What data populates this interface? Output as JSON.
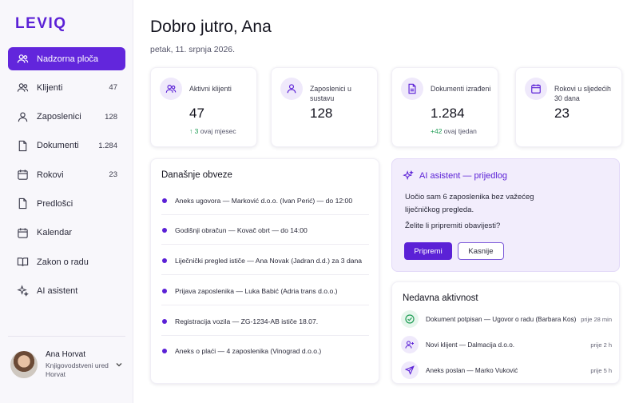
{
  "app": {
    "logo": "LEVIQ"
  },
  "sidebar": {
    "items": [
      {
        "label": "Nadzorna ploča",
        "count": "",
        "icon": "users-icon"
      },
      {
        "label": "Klijenti",
        "count": "47",
        "icon": "users-icon"
      },
      {
        "label": "Zaposlenici",
        "count": "128",
        "icon": "person-icon"
      },
      {
        "label": "Dokumenti",
        "count": "1.284",
        "icon": "document-icon"
      },
      {
        "label": "Rokovi",
        "count": "23",
        "icon": "calendar-icon"
      },
      {
        "label": "Predlošci",
        "count": "",
        "icon": "document-icon"
      },
      {
        "label": "Kalendar",
        "count": "",
        "icon": "calendar-icon"
      },
      {
        "label": "Zakon o radu",
        "count": "",
        "icon": "book-icon"
      },
      {
        "label": "AI asistent",
        "count": "",
        "icon": "sparkle-icon"
      }
    ],
    "user": {
      "name": "Ana Horvat",
      "role_line1": "Knjigovodstveni ured",
      "role_line2": "Horvat"
    }
  },
  "header": {
    "greeting": "Dobro jutro, Ana",
    "date": "petak, 11. srpnja 2026."
  },
  "stats": [
    {
      "label": "Aktivni klijenti",
      "value": "47",
      "delta": "↑ 3",
      "delta_text": " ovaj mjesec"
    },
    {
      "label": "Zaposlenici u sustavu",
      "value": "128",
      "delta": "",
      "delta_text": ""
    },
    {
      "label": "Dokumenti izrađeni",
      "value": "1.284",
      "delta": "+42",
      "delta_text": " ovaj tjedan"
    },
    {
      "label": "Rokovi u sljedećih 30 dana",
      "value": "23",
      "delta": "",
      "delta_text": ""
    }
  ],
  "obligations": {
    "title": "Današnje obveze",
    "items": [
      "Aneks ugovora — Marković d.o.o. (Ivan Perić) — do 12:00",
      "Godišnji obračun — Kovač obrt — do 14:00",
      "Liječnički pregled ističe — Ana Novak (Jadran d.d.) za 3 dana",
      "Prijava zaposlenika — Luka Babić (Adria trans d.o.o.)",
      "Registracija vozila — ZG-1234-AB ističe 18.07.",
      "Aneks o plaći — 4 zaposlenika (Vinograd d.o.o.)"
    ]
  },
  "ai": {
    "title": "AI asistent — prijedlog",
    "message": "Uočio sam 6 zaposlenika bez važećeg liječničkog pregleda.",
    "question": "Želite li pripremiti obavijesti?",
    "primary": "Pripremi",
    "secondary": "Kasnije"
  },
  "activity": {
    "title": "Nedavna aktivnost",
    "items": [
      {
        "text": "Dokument potpisan — Ugovor o radu (Barbara Kos)",
        "time": "prije 28 min",
        "icon": "check-circle-icon"
      },
      {
        "text": "Novi klijent — Dalmacija d.o.o.",
        "time": "prije 2 h",
        "icon": "user-plus-icon"
      },
      {
        "text": "Aneks poslan — Marko Vuković",
        "time": "prije 5 h",
        "icon": "send-icon"
      }
    ]
  },
  "colors": {
    "accent": "#5b21d6",
    "positive": "#1f9d55"
  }
}
